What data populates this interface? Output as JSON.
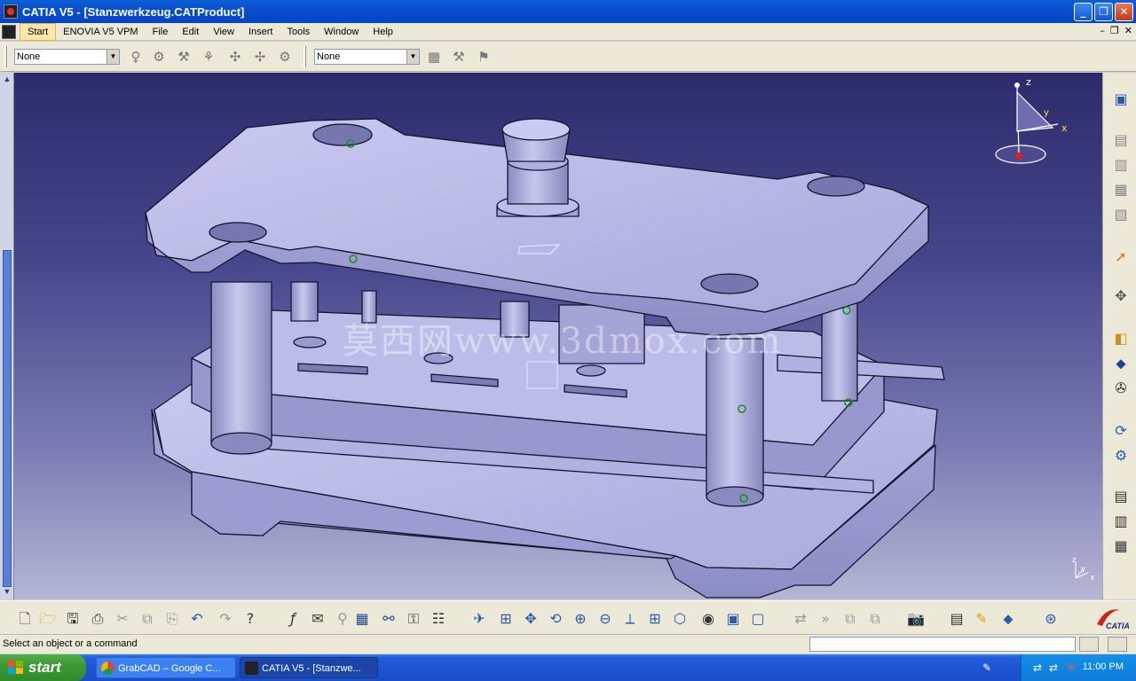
{
  "window": {
    "title": "CATIA V5 - [Stanzwerkzeug.CATProduct]",
    "minimize_icon": "_",
    "maximize_icon": "❐",
    "close_icon": "✕"
  },
  "menubar": {
    "items": [
      "Start",
      "ENOVIA V5 VPM",
      "File",
      "Edit",
      "View",
      "Insert",
      "Tools",
      "Window",
      "Help"
    ],
    "mdi_minimize": "–",
    "mdi_restore": "❐",
    "mdi_close": "✕"
  },
  "toolbar_top": {
    "combo1_value": "None",
    "combo2_value": "None",
    "combo_arrow": "▼"
  },
  "viewport": {
    "watermark": "莫西网www.3dmox.com",
    "compass_z": "z",
    "compass_x": "x",
    "compass_y": "y",
    "axis_x": "x",
    "axis_y": "y",
    "axis_z": "z"
  },
  "scroll": {
    "up": "▲",
    "down": "▼"
  },
  "statusbar": {
    "message": "Select an object or a command"
  },
  "taskbar": {
    "start_label": "start",
    "tasks": [
      {
        "label": "GrabCAD – Google C..."
      },
      {
        "label": "CATIA V5 - [Stanzwe..."
      }
    ],
    "clock": "11:00 PM"
  },
  "brand": {
    "logo_text": "CATIA"
  },
  "colors": {
    "viewport_top": "#2c2c6c",
    "viewport_bottom": "#b6b6d6",
    "part_face": "#b9b9e6",
    "part_edge": "#1a1a33",
    "taskbar": "#245edb",
    "start_green": "#3c9b36"
  }
}
